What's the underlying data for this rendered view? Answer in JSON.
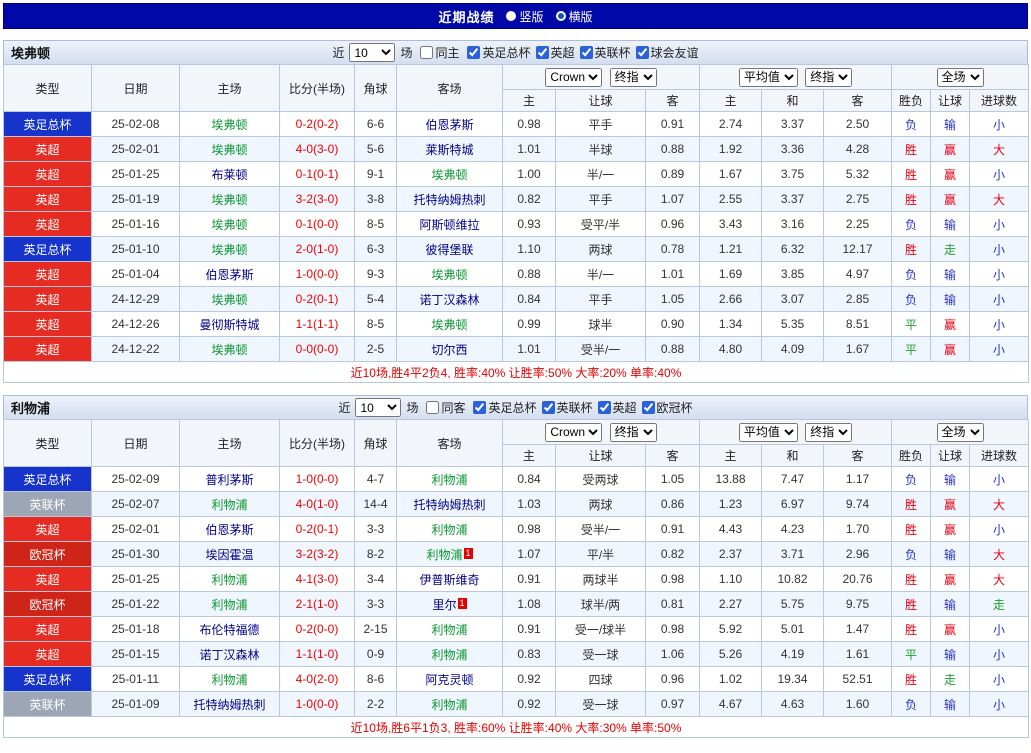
{
  "title_bar": {
    "title": "近期战绩",
    "view_modes": [
      {
        "label": "竖版",
        "selected": false
      },
      {
        "label": "横版",
        "selected": true
      }
    ]
  },
  "table": {
    "near_label": "近",
    "near_select": "10",
    "matches_label": "场",
    "col_type": "类型",
    "col_date": "日期",
    "col_home": "主场",
    "col_score": "比分(半场)",
    "col_corner": "角球",
    "col_away": "客场",
    "sel_book": "Crown",
    "sel_close1": "终指",
    "odds_h": "主",
    "odds_line": "让球",
    "odds_a": "客",
    "sel_avg": "平均值",
    "sel_close2": "终指",
    "avg_h": "主",
    "avg_d": "和",
    "avg_a": "客",
    "sel_full": "全场",
    "col_result": "胜负",
    "col_handicap": "让球",
    "col_goals": "进球数"
  },
  "type_colors": {
    "英足总杯": "#1633cc",
    "英超": "#e62b22",
    "英联杯": "#9ca6b4",
    "欧冠杯": "#cf2418"
  },
  "result_colors": {
    "win": "#e60012",
    "lose": "#2733cc",
    "push": "#1d9e2f"
  },
  "text_colors": {
    "focus_team": "#089630",
    "opponent_team": "#00008b",
    "score": "#f40000",
    "summary": "#e60000"
  },
  "sections": [
    {
      "team": "埃弗顿",
      "same_side_label": "同主",
      "same_side_checked": false,
      "competitions": [
        {
          "label": "英足总杯",
          "checked": true
        },
        {
          "label": "英超",
          "checked": true
        },
        {
          "label": "英联杯",
          "checked": true
        },
        {
          "label": "球会友谊",
          "checked": true
        }
      ],
      "rows": [
        {
          "type": "英足总杯",
          "date": "25-02-08",
          "home": "埃弗顿",
          "score": "0-2(0-2)",
          "corner": "6-6",
          "away": "伯恩茅斯",
          "odds": [
            "0.98",
            "平手",
            "0.91"
          ],
          "avg": [
            "2.74",
            "3.37",
            "2.50"
          ],
          "result": [
            "负",
            "输",
            "小"
          ]
        },
        {
          "type": "英超",
          "date": "25-02-01",
          "home": "埃弗顿",
          "score": "4-0(3-0)",
          "corner": "5-6",
          "away": "莱斯特城",
          "odds": [
            "1.01",
            "半球",
            "0.88"
          ],
          "avg": [
            "1.92",
            "3.36",
            "4.28"
          ],
          "result": [
            "胜",
            "赢",
            "大"
          ]
        },
        {
          "type": "英超",
          "date": "25-01-25",
          "home": "布莱顿",
          "score": "0-1(0-1)",
          "corner": "9-1",
          "away": "埃弗顿",
          "odds": [
            "1.00",
            "半/一",
            "0.89"
          ],
          "avg": [
            "1.67",
            "3.75",
            "5.32"
          ],
          "result": [
            "胜",
            "赢",
            "小"
          ]
        },
        {
          "type": "英超",
          "date": "25-01-19",
          "home": "埃弗顿",
          "score": "3-2(3-0)",
          "corner": "3-8",
          "away": "托特纳姆热刺",
          "odds": [
            "0.82",
            "平手",
            "1.07"
          ],
          "avg": [
            "2.55",
            "3.37",
            "2.75"
          ],
          "result": [
            "胜",
            "赢",
            "大"
          ]
        },
        {
          "type": "英超",
          "date": "25-01-16",
          "home": "埃弗顿",
          "score": "0-1(0-0)",
          "corner": "8-5",
          "away": "阿斯顿维拉",
          "odds": [
            "0.93",
            "受平/半",
            "0.96"
          ],
          "avg": [
            "3.43",
            "3.16",
            "2.25"
          ],
          "result": [
            "负",
            "输",
            "小"
          ]
        },
        {
          "type": "英足总杯",
          "date": "25-01-10",
          "home": "埃弗顿",
          "score": "2-0(1-0)",
          "corner": "6-3",
          "away": "彼得堡联",
          "odds": [
            "1.10",
            "两球",
            "0.78"
          ],
          "avg": [
            "1.21",
            "6.32",
            "12.17"
          ],
          "result": [
            "胜",
            "走",
            "小"
          ]
        },
        {
          "type": "英超",
          "date": "25-01-04",
          "home": "伯恩茅斯",
          "score": "1-0(0-0)",
          "corner": "9-3",
          "away": "埃弗顿",
          "odds": [
            "0.88",
            "半/一",
            "1.01"
          ],
          "avg": [
            "1.69",
            "3.85",
            "4.97"
          ],
          "result": [
            "负",
            "输",
            "小"
          ]
        },
        {
          "type": "英超",
          "date": "24-12-29",
          "home": "埃弗顿",
          "score": "0-2(0-1)",
          "corner": "5-4",
          "away": "诺丁汉森林",
          "odds": [
            "0.84",
            "平手",
            "1.05"
          ],
          "avg": [
            "2.66",
            "3.07",
            "2.85"
          ],
          "result": [
            "负",
            "输",
            "小"
          ]
        },
        {
          "type": "英超",
          "date": "24-12-26",
          "home": "曼彻斯特城",
          "score": "1-1(1-1)",
          "corner": "8-5",
          "away": "埃弗顿",
          "odds": [
            "0.99",
            "球半",
            "0.90"
          ],
          "avg": [
            "1.34",
            "5.35",
            "8.51"
          ],
          "result": [
            "平",
            "赢",
            "小"
          ]
        },
        {
          "type": "英超",
          "date": "24-12-22",
          "home": "埃弗顿",
          "score": "0-0(0-0)",
          "corner": "2-5",
          "away": "切尔西",
          "odds": [
            "1.01",
            "受半/一",
            "0.88"
          ],
          "avg": [
            "4.80",
            "4.09",
            "1.67"
          ],
          "result": [
            "平",
            "赢",
            "小"
          ]
        }
      ],
      "summary": "近10场,胜4平2负4, 胜率:40% 让胜率:50% 大率:20% 单率:40%"
    },
    {
      "team": "利物浦",
      "same_side_label": "同客",
      "same_side_checked": false,
      "competitions": [
        {
          "label": "英足总杯",
          "checked": true
        },
        {
          "label": "英联杯",
          "checked": true
        },
        {
          "label": "英超",
          "checked": true
        },
        {
          "label": "欧冠杯",
          "checked": true
        }
      ],
      "rows": [
        {
          "type": "英足总杯",
          "date": "25-02-09",
          "home": "普利茅斯",
          "score": "1-0(0-0)",
          "corner": "4-7",
          "away": "利物浦",
          "odds": [
            "0.84",
            "受两球",
            "1.05"
          ],
          "avg": [
            "13.88",
            "7.47",
            "1.17"
          ],
          "result": [
            "负",
            "输",
            "小"
          ]
        },
        {
          "type": "英联杯",
          "date": "25-02-07",
          "home": "利物浦",
          "score": "4-0(1-0)",
          "corner": "14-4",
          "away": "托特纳姆热刺",
          "odds": [
            "1.03",
            "两球",
            "0.86"
          ],
          "avg": [
            "1.23",
            "6.97",
            "9.74"
          ],
          "result": [
            "胜",
            "赢",
            "大"
          ]
        },
        {
          "type": "英超",
          "date": "25-02-01",
          "home": "伯恩茅斯",
          "score": "0-2(0-1)",
          "corner": "3-3",
          "away": "利物浦",
          "odds": [
            "0.98",
            "受半/一",
            "0.91"
          ],
          "avg": [
            "4.43",
            "4.23",
            "1.70"
          ],
          "result": [
            "胜",
            "赢",
            "小"
          ]
        },
        {
          "type": "欧冠杯",
          "date": "25-01-30",
          "home": "埃因霍温",
          "score": "3-2(3-2)",
          "corner": "8-2",
          "away": "利物浦",
          "away_cards": 1,
          "odds": [
            "1.07",
            "平/半",
            "0.82"
          ],
          "avg": [
            "2.37",
            "3.71",
            "2.96"
          ],
          "result": [
            "负",
            "输",
            "大"
          ]
        },
        {
          "type": "英超",
          "date": "25-01-25",
          "home": "利物浦",
          "score": "4-1(3-0)",
          "corner": "3-4",
          "away": "伊普斯维奇",
          "odds": [
            "0.91",
            "两球半",
            "0.98"
          ],
          "avg": [
            "1.10",
            "10.82",
            "20.76"
          ],
          "result": [
            "胜",
            "赢",
            "大"
          ]
        },
        {
          "type": "欧冠杯",
          "date": "25-01-22",
          "home": "利物浦",
          "score": "2-1(1-0)",
          "corner": "3-3",
          "away": "里尔",
          "away_cards": 1,
          "odds": [
            "1.08",
            "球半/两",
            "0.81"
          ],
          "avg": [
            "2.27",
            "5.75",
            "9.75"
          ],
          "result": [
            "胜",
            "输",
            "走"
          ]
        },
        {
          "type": "英超",
          "date": "25-01-18",
          "home": "布伦特福德",
          "score": "0-2(0-0)",
          "corner": "2-15",
          "away": "利物浦",
          "odds": [
            "0.91",
            "受一/球半",
            "0.98"
          ],
          "avg": [
            "5.92",
            "5.01",
            "1.47"
          ],
          "result": [
            "胜",
            "赢",
            "小"
          ]
        },
        {
          "type": "英超",
          "date": "25-01-15",
          "home": "诺丁汉森林",
          "score": "1-1(1-0)",
          "corner": "0-9",
          "away": "利物浦",
          "odds": [
            "0.83",
            "受一球",
            "1.06"
          ],
          "avg": [
            "5.26",
            "4.19",
            "1.61"
          ],
          "result": [
            "平",
            "输",
            "小"
          ]
        },
        {
          "type": "英足总杯",
          "date": "25-01-11",
          "home": "利物浦",
          "score": "4-0(2-0)",
          "corner": "8-6",
          "away": "阿克灵顿",
          "odds": [
            "0.92",
            "四球",
            "0.96"
          ],
          "avg": [
            "1.02",
            "19.34",
            "52.51"
          ],
          "result": [
            "胜",
            "走",
            "小"
          ]
        },
        {
          "type": "英联杯",
          "date": "25-01-09",
          "home": "托特纳姆热刺",
          "score": "1-0(0-0)",
          "corner": "2-2",
          "away": "利物浦",
          "odds": [
            "0.92",
            "受一球",
            "0.97"
          ],
          "avg": [
            "4.67",
            "4.63",
            "1.60"
          ],
          "result": [
            "负",
            "输",
            "小"
          ]
        }
      ],
      "summary": "近10场,胜6平1负3, 胜率:60% 让胜率:40% 大率:30% 单率:50%"
    }
  ]
}
